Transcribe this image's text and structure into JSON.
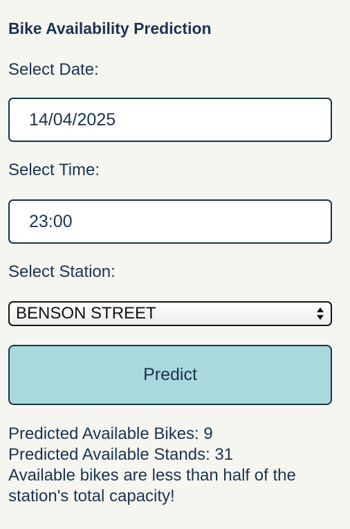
{
  "header": {
    "title": "Bike Availability Prediction"
  },
  "form": {
    "date_label": "Select Date:",
    "date_value": "14/04/2025",
    "time_label": "Select Time:",
    "time_value": "23:00",
    "station_label": "Select Station:",
    "station_value": "BENSON STREET",
    "predict_label": "Predict"
  },
  "result": {
    "bikes": "Predicted Available Bikes: 9",
    "stands": "Predicted Available Stands: 31",
    "warning": "Available bikes are less than half of the station's total capacity!"
  },
  "icons": {
    "select_arrows": "updown-arrows-icon"
  },
  "colors": {
    "background": "#f6f6f1",
    "text": "#1b3350",
    "border": "#12344b",
    "button": "#a9d9dc"
  }
}
